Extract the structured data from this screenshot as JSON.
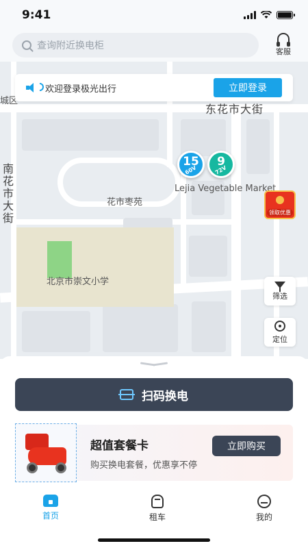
{
  "status_bar": {
    "time": "9:41"
  },
  "search": {
    "placeholder": "查询附近换电柜"
  },
  "service": {
    "label": "客服"
  },
  "login_banner": {
    "text": "欢迎登录极光出行",
    "button": "立即登录"
  },
  "map": {
    "labels": {
      "district": "城区",
      "east_street": "东花市大街",
      "south_street": "南花市大街",
      "residential": "花市枣苑",
      "market": "Lejia Vegetable Market",
      "school": "北京市崇文小学"
    },
    "markers": [
      {
        "number": "15",
        "voltage": "60V",
        "color": "#1aa3e8"
      },
      {
        "number": "9",
        "voltage": "72V",
        "color": "#16b8a0"
      }
    ],
    "red_packet": {
      "label": "领取优惠"
    },
    "tools": {
      "filter": "筛选",
      "locate": "定位"
    }
  },
  "scan_button": {
    "label": "扫码换电"
  },
  "promo": {
    "title": "超值套餐卡",
    "desc": "购买换电套餐，优惠享不停",
    "button": "立即购买"
  },
  "tabs": [
    {
      "label": "首页",
      "icon": "home-icon",
      "active": true
    },
    {
      "label": "租车",
      "icon": "scooter-icon",
      "active": false
    },
    {
      "label": "我的",
      "icon": "mine-icon",
      "active": false
    }
  ],
  "colors": {
    "accent": "#1aa3e8",
    "dark_button": "#3b4556"
  }
}
